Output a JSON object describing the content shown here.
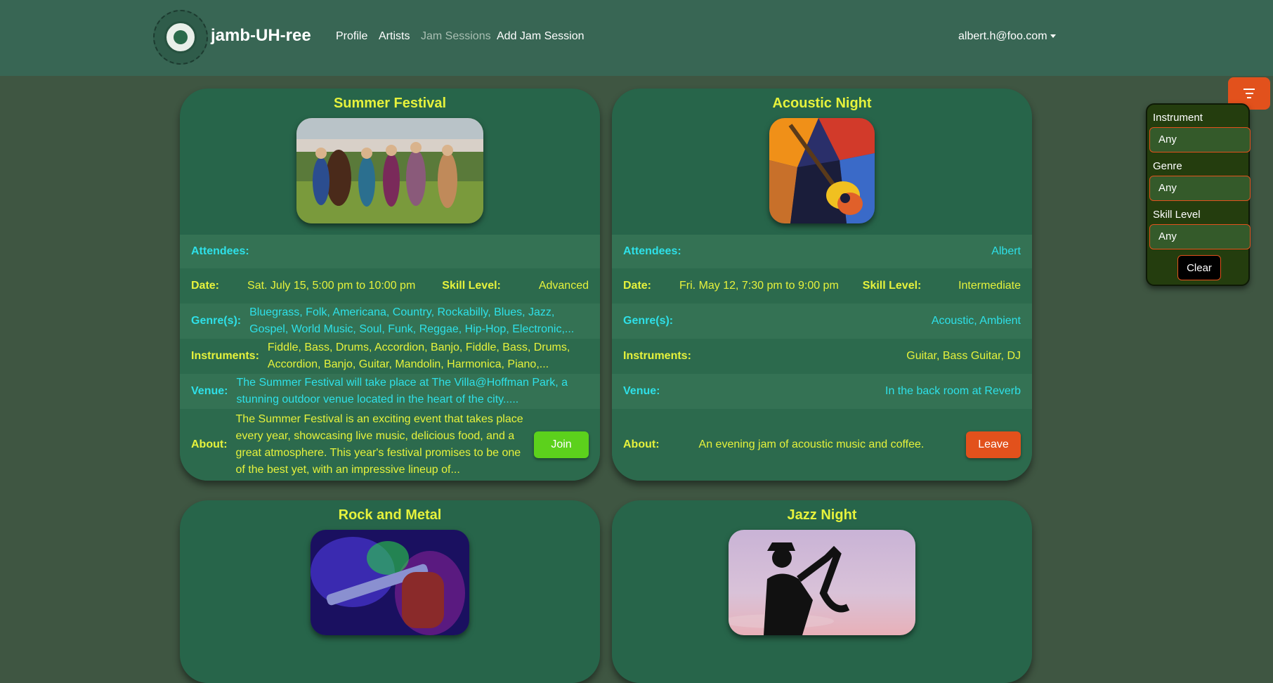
{
  "nav": {
    "brand": "jamb-UH-ree",
    "links": [
      "Profile",
      "Artists",
      "Jam Sessions",
      "Add Jam Session"
    ],
    "user": "albert.h@foo.com"
  },
  "labels": {
    "attendees": "Attendees:",
    "date": "Date:",
    "skill": "Skill Level:",
    "genres": "Genre(s):",
    "instruments": "Instruments:",
    "venue": "Venue:",
    "about": "About:"
  },
  "sessions": [
    {
      "title": "Summer Festival",
      "attendees": "",
      "date": "Sat. July 15, 5:00 pm to 10:00 pm",
      "skill": "Advanced",
      "genres": "Bluegrass, Folk, Americana, Country, Rockabilly, Blues, Jazz, Gospel, World Music, Soul, Funk, Reggae, Hip-Hop, Electronic,...",
      "instruments": "Fiddle, Bass, Drums, Accordion, Banjo, Fiddle, Bass, Drums, Accordion, Banjo, Guitar, Mandolin, Harmonica, Piano,...",
      "venue": "The Summer Festival will take place at The Villa@Hoffman Park, a stunning outdoor venue located in the heart of the city.....",
      "about": "The Summer Festival is an exciting event that takes place every year, showcasing live music, delicious food, and a great atmosphere. This year's festival promises to be one of the best yet, with an impressive lineup of...",
      "action": "Join"
    },
    {
      "title": "Acoustic Night",
      "attendees": "Albert",
      "date": "Fri. May 12, 7:30 pm to 9:00 pm",
      "skill": "Intermediate",
      "genres": "Acoustic, Ambient",
      "instruments": "Guitar, Bass Guitar, DJ",
      "venue": "In the back room at Reverb",
      "about": "An evening jam of acoustic music and coffee.",
      "action": "Leave"
    },
    {
      "title": "Rock and Metal"
    },
    {
      "title": "Jazz Night"
    }
  ],
  "filter": {
    "instrument_label": "Instrument",
    "instrument_value": "Any",
    "genre_label": "Genre",
    "genre_value": "Any",
    "skill_label": "Skill Level",
    "skill_value": "Any",
    "clear": "Clear"
  },
  "icons": {
    "logo": "circular-seal-logo",
    "filter": "filter-lines-icon",
    "caret": "chevron-down-icon"
  },
  "colors": {
    "navbar": "#386654",
    "card": "#27654a",
    "title": "#e6f23c",
    "cyan_text": "#2ee0e8",
    "join": "#5cd11c",
    "leave": "#e2511c"
  }
}
